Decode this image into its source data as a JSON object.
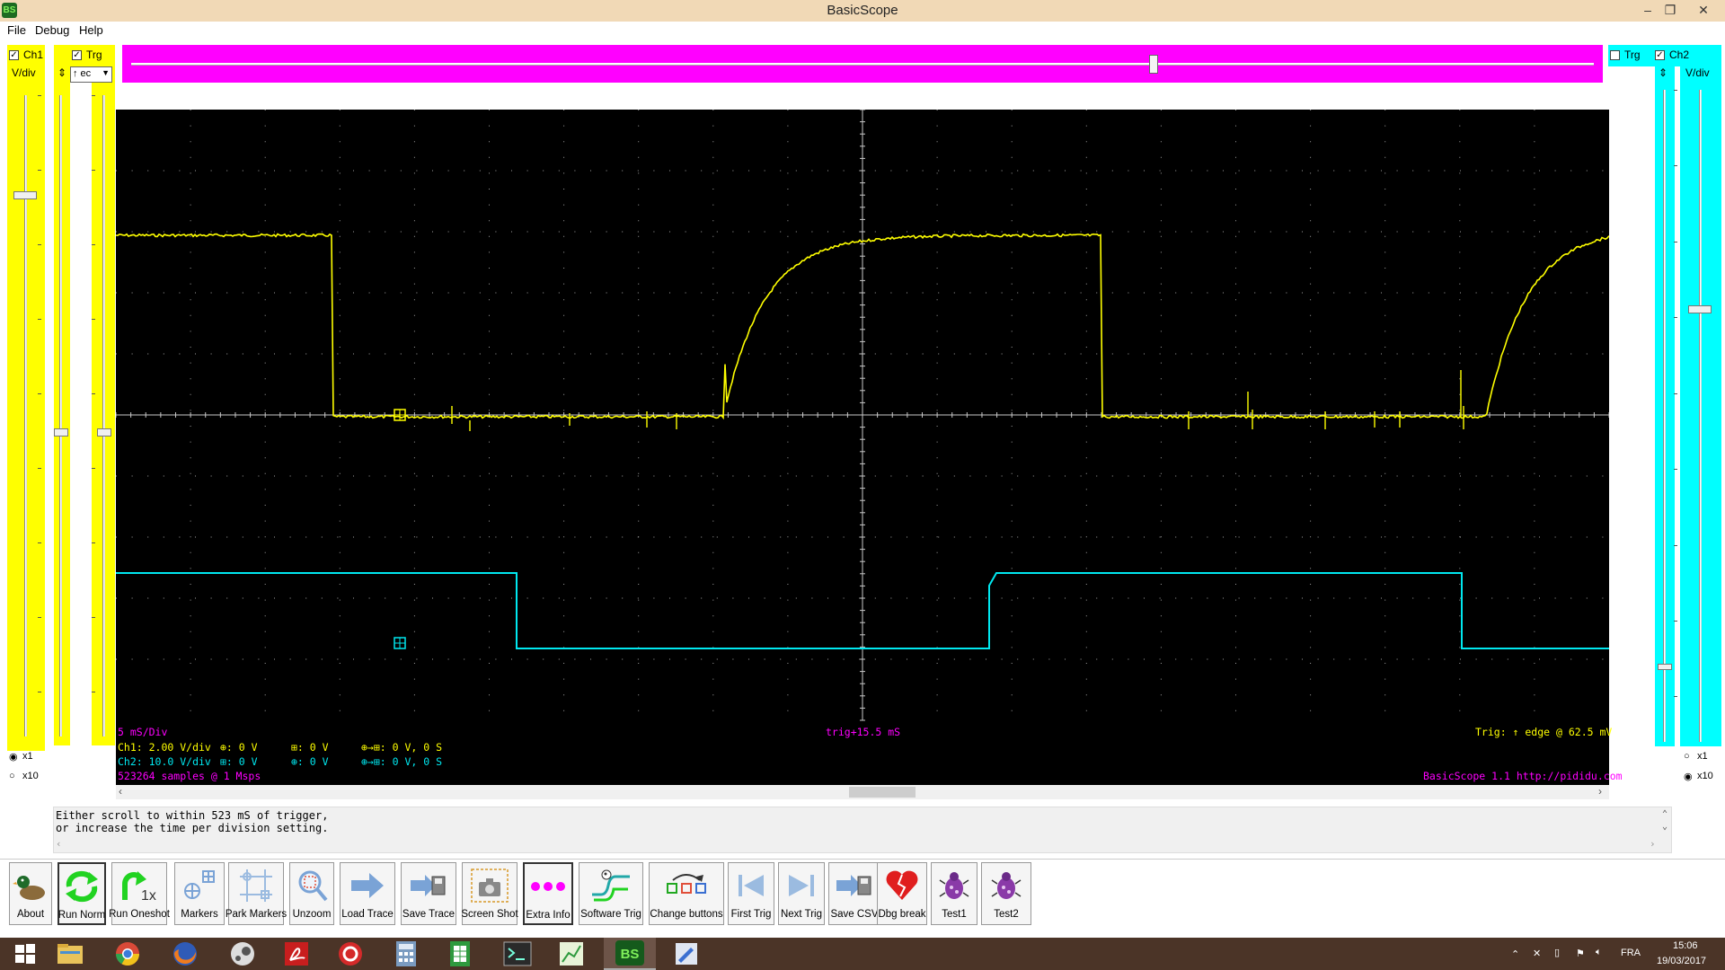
{
  "window": {
    "title": "BasicScope",
    "app_icon_text": "BS",
    "controls": [
      "–",
      "❐",
      "✕"
    ]
  },
  "menu": {
    "items": [
      {
        "label": "File"
      },
      {
        "label": "Debug"
      },
      {
        "label": "Help"
      }
    ]
  },
  "ch1_panel": {
    "enable_label": "Ch1",
    "enable_checked": true,
    "vdiv_label": "V/div",
    "trig_label": "Trg",
    "trig_checked": true,
    "trig_mode_value": "↑ ec",
    "x1_label": "x1",
    "x10_label": "x10",
    "x1_selected": true,
    "vdiv_slider_level": 0.15,
    "offset_slider_level": 0.52,
    "trig_slider_level": 0.52
  },
  "ch2_panel": {
    "enable_label": "Ch2",
    "enable_checked": true,
    "vdiv_label": "V/div",
    "trig_label": "Trg",
    "trig_checked": false,
    "x1_label": "x1",
    "x10_label": "x10",
    "x10_selected": true,
    "vdiv_slider_level": 0.33,
    "offset_slider_level": 0.88
  },
  "time_slider": {
    "level": 0.7
  },
  "scope": {
    "colors": {
      "background": "#000000",
      "ch1": "#ffff00",
      "ch2": "#00e8f0",
      "info": "#ff00ff",
      "grid": "#c8c8c8"
    },
    "timebase": "5 mS/Div",
    "trigger_offset": "trig+15.5 mS",
    "trigger_info": "Trig: ↑ edge @ 62.5 mV",
    "ch1_line": {
      "vdiv": "Ch1: 2.00 V/div",
      "offset": "⊕: 0 V",
      "marker": "⊞: 0 V",
      "delta": "⊕→⊞: 0 V, 0 S"
    },
    "ch2_line": {
      "vdiv": "Ch2: 10.0 V/div",
      "offset": "⊞: 0 V",
      "marker": "⊕: 0 V",
      "delta": "⊕→⊞: 0 V, 0 S"
    },
    "samples": "523264 samples @ 1 Msps",
    "version": "BasicScope 1.1 http://pididu.com"
  },
  "message": {
    "line1": "Either scroll to within 523 mS of trigger,",
    "line2": "or increase the time per division setting."
  },
  "toolbar": {
    "buttons": [
      {
        "label": "About",
        "icon": "duck-icon"
      },
      {
        "label": "Run Norm",
        "icon": "repeat-arrows-icon"
      },
      {
        "label": "Run Oneshot",
        "icon": "oneshot-icon"
      },
      {
        "label": "Markers",
        "icon": "markers-icon"
      },
      {
        "label": "Park Markers",
        "icon": "park-markers-icon"
      },
      {
        "label": "Unzoom",
        "icon": "magnifier-icon"
      },
      {
        "label": "Load Trace",
        "icon": "load-trace-icon"
      },
      {
        "label": "Save Trace",
        "icon": "save-trace-icon"
      },
      {
        "label": "Screen Shot",
        "icon": "camera-icon"
      },
      {
        "label": "Extra Info",
        "icon": "dots-icon"
      },
      {
        "label": "Software Trig",
        "icon": "software-trig-icon"
      },
      {
        "label": "Change buttons",
        "icon": "change-buttons-icon"
      },
      {
        "label": "First Trig",
        "icon": "first-trig-icon"
      },
      {
        "label": "Next Trig",
        "icon": "next-trig-icon"
      },
      {
        "label": "Save CSV",
        "icon": "save-csv-icon"
      },
      {
        "label": "Dbg break",
        "icon": "broken-heart-icon"
      },
      {
        "label": "Test1",
        "icon": "bug-icon"
      },
      {
        "label": "Test2",
        "icon": "bug-icon"
      }
    ]
  },
  "taskbar": {
    "apps": [
      "windows-start-icon",
      "file-explorer-icon",
      "chrome-icon",
      "firefox-icon",
      "steam-icon",
      "acrobat-icon",
      "media-icon",
      "calculator-icon",
      "spreadsheet-icon",
      "terminal-icon",
      "chart-app-icon",
      "basicscope-icon",
      "paint-icon"
    ],
    "language": "FRA",
    "time": "15:06",
    "date": "19/03/2017"
  }
}
